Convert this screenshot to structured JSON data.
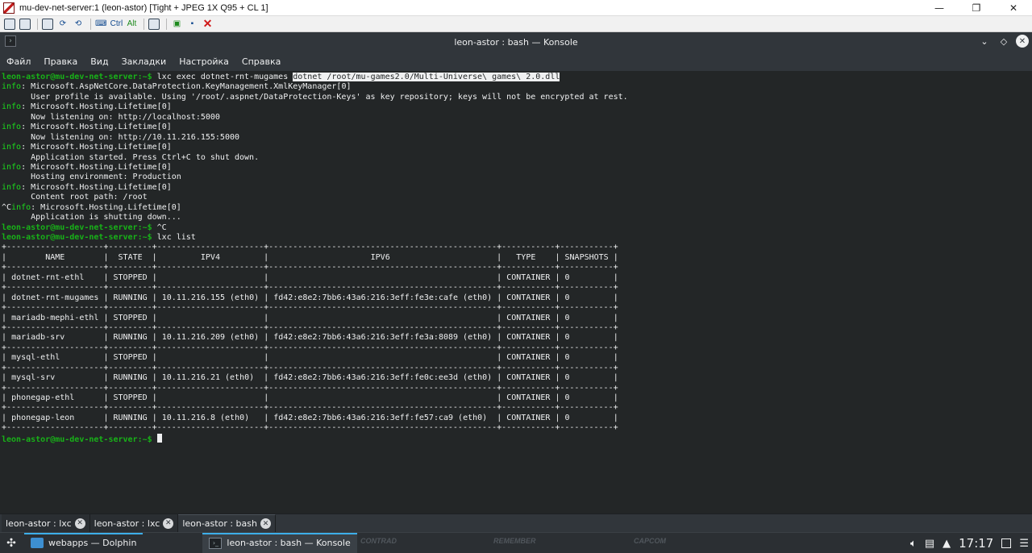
{
  "vnc": {
    "title": "mu-dev-net-server:1 (leon-astor) [Tight + JPEG 1X Q95 + CL 1]",
    "ctrl_label": "Ctrl",
    "alt_label": "Alt",
    "minimize": "—",
    "maximize": "❐",
    "close": "✕"
  },
  "konsole": {
    "title": "leon-astor : bash — Konsole",
    "menu": [
      "Файл",
      "Правка",
      "Вид",
      "Закладки",
      "Настройка",
      "Справка"
    ],
    "controls": {
      "collapse": "⌄",
      "float": "◇",
      "close": "✕"
    }
  },
  "terminal": {
    "prompt": "leon-astor@mu-dev-net-server:~$ ",
    "cmd1": "lxc exec dotnet-rnt-mugames ",
    "cmd1_selected": "dotnet /root/mu-games2.0/Multi-Universe\\ games\\ 2.0.dll",
    "log": [
      {
        "tag": "info",
        "text": ": Microsoft.AspNetCore.DataProtection.KeyManagement.XmlKeyManager[0]"
      },
      {
        "tag": "",
        "text": "      User profile is available. Using '/root/.aspnet/DataProtection-Keys' as key repository; keys will not be encrypted at rest."
      },
      {
        "tag": "info",
        "text": ": Microsoft.Hosting.Lifetime[0]"
      },
      {
        "tag": "",
        "text": "      Now listening on: http://localhost:5000"
      },
      {
        "tag": "info",
        "text": ": Microsoft.Hosting.Lifetime[0]"
      },
      {
        "tag": "",
        "text": "      Now listening on: http://10.11.216.155:5000"
      },
      {
        "tag": "info",
        "text": ": Microsoft.Hosting.Lifetime[0]"
      },
      {
        "tag": "",
        "text": "      Application started. Press Ctrl+C to shut down."
      },
      {
        "tag": "info",
        "text": ": Microsoft.Hosting.Lifetime[0]"
      },
      {
        "tag": "",
        "text": "      Hosting environment: Production"
      },
      {
        "tag": "info",
        "text": ": Microsoft.Hosting.Lifetime[0]"
      },
      {
        "tag": "",
        "text": "      Content root path: /root"
      }
    ],
    "ctrl_c_prefix": "^C",
    "ctrl_c_tag": "info",
    "ctrl_c_rest": ": Microsoft.Hosting.Lifetime[0]",
    "shutdown": "      Application is shutting down...",
    "cmd2": "^C",
    "cmd3": "lxc list",
    "table_headers": [
      "NAME",
      "STATE",
      "IPV4",
      "IPV6",
      "TYPE",
      "SNAPSHOTS"
    ],
    "table_rows": [
      [
        "dotnet-rnt-ethl",
        "STOPPED",
        "",
        "",
        "CONTAINER",
        "0"
      ],
      [
        "dotnet-rnt-mugames",
        "RUNNING",
        "10.11.216.155 (eth0)",
        "fd42:e8e2:7bb6:43a6:216:3eff:fe3e:cafe (eth0)",
        "CONTAINER",
        "0"
      ],
      [
        "mariadb-mephi-ethl",
        "STOPPED",
        "",
        "",
        "CONTAINER",
        "0"
      ],
      [
        "mariadb-srv",
        "RUNNING",
        "10.11.216.209 (eth0)",
        "fd42:e8e2:7bb6:43a6:216:3eff:fe3a:8089 (eth0)",
        "CONTAINER",
        "0"
      ],
      [
        "mysql-ethl",
        "STOPPED",
        "",
        "",
        "CONTAINER",
        "0"
      ],
      [
        "mysql-srv",
        "RUNNING",
        "10.11.216.21 (eth0)",
        "fd42:e8e2:7bb6:43a6:216:3eff:fe0c:ee3d (eth0)",
        "CONTAINER",
        "0"
      ],
      [
        "phonegap-ethl",
        "STOPPED",
        "",
        "",
        "CONTAINER",
        "0"
      ],
      [
        "phonegap-leon",
        "RUNNING",
        "10.11.216.8 (eth0)",
        "fd42:e8e2:7bb6:43a6:216:3eff:fe57:ca9 (eth0)",
        "CONTAINER",
        "0"
      ]
    ]
  },
  "tabs": [
    {
      "label": "leon-astor : lxc"
    },
    {
      "label": "leon-astor : lxc"
    },
    {
      "label": "leon-astor : bash"
    }
  ],
  "taskbar": {
    "tasks": [
      {
        "label": "webapps — Dolphin"
      },
      {
        "label": "leon-astor : bash — Konsole"
      }
    ],
    "ghost_labels": [
      "CONTRAD",
      "REMEMBER",
      "CAPCOM"
    ],
    "clock": "17:17"
  },
  "colors": {
    "terminal_bg": "#232627",
    "prompt_green": "#18b218",
    "info_green": "#1cdc1c",
    "panel_bg": "#2b2f33",
    "accent": "#3daee9"
  }
}
